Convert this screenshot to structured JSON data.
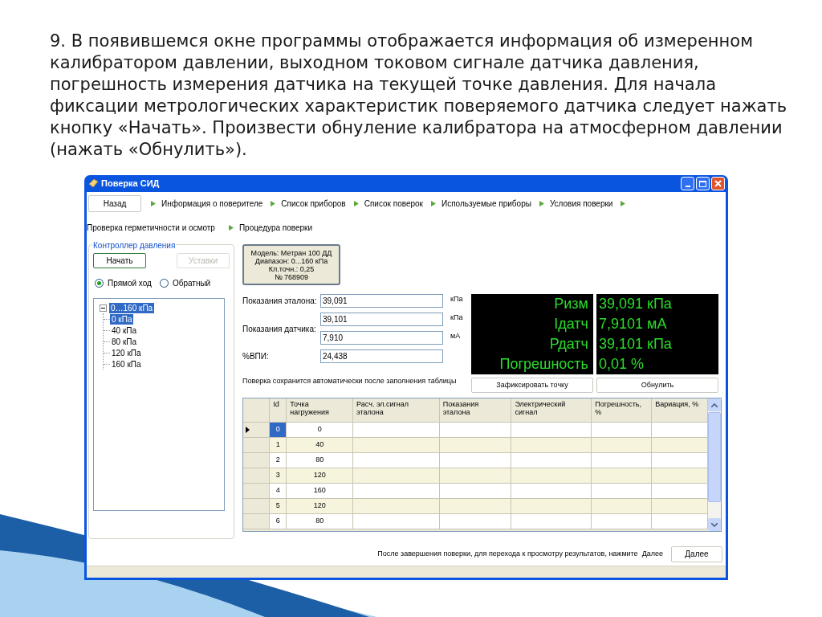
{
  "slide_text": "9. В появившемся окне программы отображается информация об измеренном калибратором давлении, выходном токовом сигнале датчика давления, погрешность измерения датчика на текущей точке давления. Для начала фиксации метрологических характеристик поверяемого датчика следует нажать кнопку «Начать». Произвести обнуление калибратора на атмосферном давлении (нажать «Обнулить»).",
  "window": {
    "title": "Поверка СИД"
  },
  "back_button": "Назад",
  "steps": [
    "Информация о поверителе",
    "Список приборов",
    "Список поверок",
    "Используемые приборы",
    "Условия поверки",
    "Проверка герметичности и осмотр",
    "Процедура поверки"
  ],
  "pressure_controller": {
    "title": "Контроллер давления",
    "buttons": [
      {
        "label": "Начать",
        "disabled": false
      },
      {
        "label": "Уставки",
        "disabled": true
      }
    ],
    "direction": [
      {
        "label": "Прямой ход",
        "selected": true
      },
      {
        "label": "Обратный",
        "selected": false
      }
    ],
    "tree": [
      {
        "label": "0…160 кПа",
        "selected": true,
        "expanded": true,
        "children": [
          {
            "label": "0 кПа",
            "selected": true
          },
          {
            "label": "40 кПа",
            "selected": false
          },
          {
            "label": "80 кПа",
            "selected": false
          },
          {
            "label": "120 кПа",
            "selected": false
          },
          {
            "label": "160 кПа",
            "selected": false
          }
        ]
      }
    ]
  },
  "device_info": [
    "Модель: Метран 100 ДД",
    "Диапазон: 0...160 кПа",
    "Кл.точн.: 0,25",
    "№ 768909"
  ],
  "readings": [
    {
      "label": "Показания эталона:",
      "inputs": [
        {
          "value": "39,091",
          "unit": "кПа"
        }
      ]
    },
    {
      "label": "Показания датчика:",
      "inputs": [
        {
          "value": "39,101",
          "unit": "кПа"
        },
        {
          "value": "7,910",
          "unit": "мА"
        }
      ]
    },
    {
      "label": "%ВПИ:",
      "inputs": [
        {
          "value": "24,438"
        }
      ]
    }
  ],
  "display": [
    {
      "label": "Ризм",
      "value": "39,091 кПа"
    },
    {
      "label": "Iдатч",
      "value": "7,9101 мА"
    },
    {
      "label": "Рдатч",
      "value": "39,101 кПа"
    },
    {
      "label": "Погрешность",
      "value": "0,01 %"
    }
  ],
  "note": "Поверка сохранится автоматически после заполнения таблицы",
  "actions": [
    "Зафиксировать точку",
    "Обнулить"
  ],
  "table": {
    "columns": [
      "Id",
      "Точка нагружения",
      "Расч. эл.сигнал эталона",
      "Показания эталона",
      "Электрический сигнал",
      "Погрешность, %",
      "Вариация, %"
    ],
    "rows": [
      {
        "id": "0",
        "point": "0",
        "selected": true
      },
      {
        "id": "1",
        "point": "40",
        "selected": false
      },
      {
        "id": "2",
        "point": "80",
        "selected": false
      },
      {
        "id": "3",
        "point": "120",
        "selected": false
      },
      {
        "id": "4",
        "point": "160",
        "selected": false
      },
      {
        "id": "5",
        "point": "120",
        "selected": false
      },
      {
        "id": "6",
        "point": "80",
        "selected": false
      }
    ]
  },
  "footer": {
    "text": "После завершения поверки, для перехода к просмотру результатов, нажмите  Далее",
    "button": "Далее"
  }
}
